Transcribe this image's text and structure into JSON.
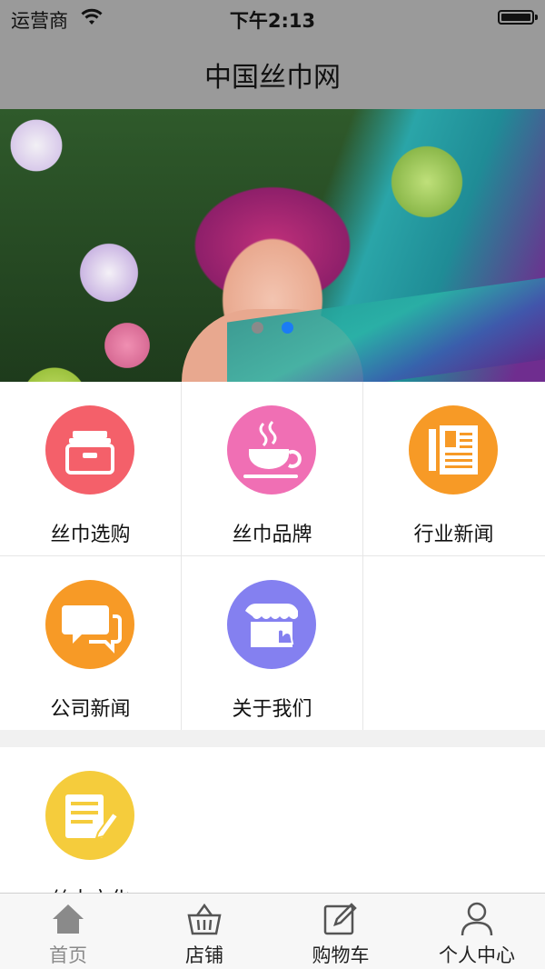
{
  "status_bar": {
    "carrier": "运营商",
    "time": "下午2:13",
    "icons": [
      "wifi-icon",
      "battery-icon"
    ]
  },
  "nav_bar": {
    "title": "中国丝巾网"
  },
  "banner": {
    "page_count": 2,
    "active_page": 2
  },
  "grid": {
    "items": [
      {
        "label": "丝巾选购",
        "icon": "basket-icon",
        "color": "#f4606a"
      },
      {
        "label": "丝巾品牌",
        "icon": "teacup-icon",
        "color": "#f06fb4"
      },
      {
        "label": "行业新闻",
        "icon": "newspaper-icon",
        "color": "#f79a26"
      },
      {
        "label": "公司新闻",
        "icon": "chat-icon",
        "color": "#f79a26"
      },
      {
        "label": "关于我们",
        "icon": "shop-icon",
        "color": "#8480f0"
      }
    ]
  },
  "section2": {
    "items": [
      {
        "label": "丝巾文化",
        "icon": "document-edit-icon",
        "color": "#f5cc3c"
      }
    ]
  },
  "tab_bar": {
    "tabs": [
      {
        "label": "首页",
        "icon": "home-icon",
        "active": true
      },
      {
        "label": "店铺",
        "icon": "basket-icon",
        "active": false
      },
      {
        "label": "购物车",
        "icon": "edit-icon",
        "active": false
      },
      {
        "label": "个人中心",
        "icon": "person-icon",
        "active": false
      }
    ]
  }
}
